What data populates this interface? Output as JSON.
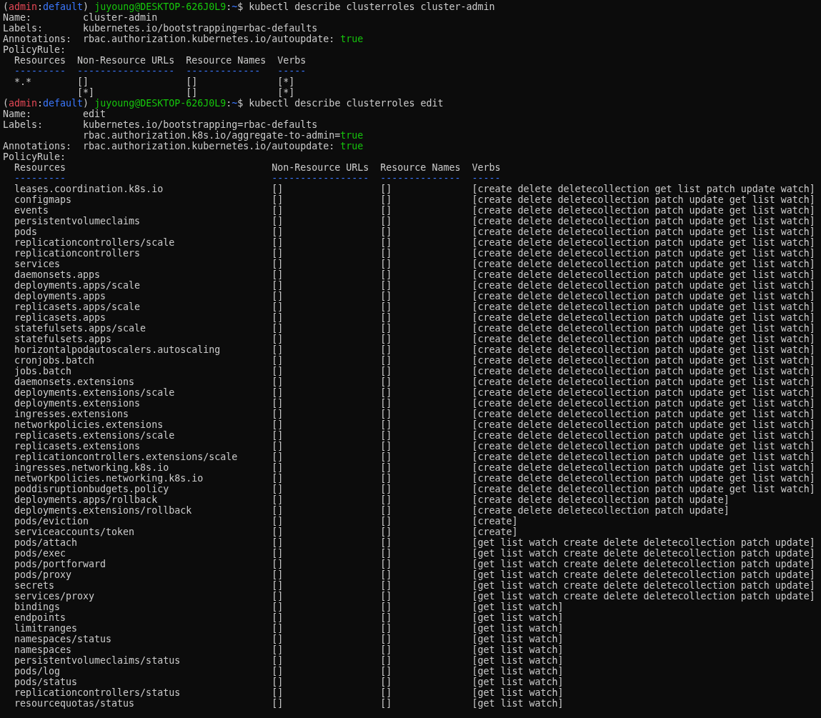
{
  "terminal": {
    "sessions": [
      {
        "prompt": [
          {
            "text": "(",
            "kind": "text"
          },
          {
            "text": "admin",
            "kind": "context"
          },
          {
            "text": ":",
            "kind": "text"
          },
          {
            "text": "default",
            "kind": "namespace"
          },
          {
            "text": ")",
            "kind": "text"
          },
          {
            "text": "juyoung@DESKTOP-626J0L9",
            "kind": "host"
          },
          {
            "text": ":",
            "kind": "text"
          },
          {
            "text": "~",
            "kind": "path"
          },
          {
            "text": "$",
            "kind": "text"
          }
        ],
        "command": "kubectl describe clusterroles cluster-admin",
        "fields": [
          {
            "label": "Name:",
            "values": [
              [
                {
                  "text": "cluster-admin",
                  "kind": "text"
                }
              ]
            ]
          },
          {
            "label": "Labels:",
            "values": [
              [
                {
                  "text": "kubernetes.io/bootstrapping=rbac-defaults",
                  "kind": "text"
                }
              ]
            ]
          },
          {
            "label": "Annotations:",
            "values": [
              [
                {
                  "text": "rbac.authorization.kubernetes.io/autoupdate: ",
                  "kind": "text"
                },
                {
                  "text": "true",
                  "kind": "bool"
                }
              ]
            ]
          }
        ],
        "section": "PolicyRule:",
        "table": {
          "columns": [
            {
              "header": "Resources",
              "rule": "---------"
            },
            {
              "header": "Non-Resource URLs",
              "rule": "-----------------"
            },
            {
              "header": "Resource Names",
              "rule": "-------------"
            },
            {
              "header": "Verbs",
              "rule": "-----"
            }
          ],
          "rows": [
            [
              "*.*",
              "[]",
              "[]",
              "[*]"
            ],
            [
              "",
              "[*]",
              "[]",
              "[*]"
            ]
          ]
        }
      },
      {
        "prompt": [
          {
            "text": "(",
            "kind": "text"
          },
          {
            "text": "admin",
            "kind": "context"
          },
          {
            "text": ":",
            "kind": "text"
          },
          {
            "text": "default",
            "kind": "namespace"
          },
          {
            "text": ")",
            "kind": "text"
          },
          {
            "text": "juyoung@DESKTOP-626J0L9",
            "kind": "host"
          },
          {
            "text": ":",
            "kind": "text"
          },
          {
            "text": "~",
            "kind": "path"
          },
          {
            "text": "$",
            "kind": "text"
          }
        ],
        "command": "kubectl describe clusterroles edit",
        "fields": [
          {
            "label": "Name:",
            "values": [
              [
                {
                  "text": "edit",
                  "kind": "text"
                }
              ]
            ]
          },
          {
            "label": "Labels:",
            "values": [
              [
                {
                  "text": "kubernetes.io/bootstrapping=rbac-defaults",
                  "kind": "text"
                }
              ],
              [
                {
                  "text": "rbac.authorization.k8s.io/aggregate-to-admin=",
                  "kind": "text"
                },
                {
                  "text": "true",
                  "kind": "bool"
                }
              ]
            ]
          },
          {
            "label": "Annotations:",
            "values": [
              [
                {
                  "text": "rbac.authorization.kubernetes.io/autoupdate: ",
                  "kind": "text"
                },
                {
                  "text": "true",
                  "kind": "bool"
                }
              ]
            ]
          }
        ],
        "section": "PolicyRule:",
        "table": {
          "columns": [
            {
              "header": "Resources",
              "rule": "---------"
            },
            {
              "header": "Non-Resource URLs",
              "rule": "-----------------"
            },
            {
              "header": "Resource Names",
              "rule": "--------------"
            },
            {
              "header": "Verbs",
              "rule": "-----"
            }
          ],
          "rows": [
            [
              "leases.coordination.k8s.io",
              "[]",
              "[]",
              "[create delete deletecollection get list patch update watch]"
            ],
            [
              "configmaps",
              "[]",
              "[]",
              "[create delete deletecollection patch update get list watch]"
            ],
            [
              "events",
              "[]",
              "[]",
              "[create delete deletecollection patch update get list watch]"
            ],
            [
              "persistentvolumeclaims",
              "[]",
              "[]",
              "[create delete deletecollection patch update get list watch]"
            ],
            [
              "pods",
              "[]",
              "[]",
              "[create delete deletecollection patch update get list watch]"
            ],
            [
              "replicationcontrollers/scale",
              "[]",
              "[]",
              "[create delete deletecollection patch update get list watch]"
            ],
            [
              "replicationcontrollers",
              "[]",
              "[]",
              "[create delete deletecollection patch update get list watch]"
            ],
            [
              "services",
              "[]",
              "[]",
              "[create delete deletecollection patch update get list watch]"
            ],
            [
              "daemonsets.apps",
              "[]",
              "[]",
              "[create delete deletecollection patch update get list watch]"
            ],
            [
              "deployments.apps/scale",
              "[]",
              "[]",
              "[create delete deletecollection patch update get list watch]"
            ],
            [
              "deployments.apps",
              "[]",
              "[]",
              "[create delete deletecollection patch update get list watch]"
            ],
            [
              "replicasets.apps/scale",
              "[]",
              "[]",
              "[create delete deletecollection patch update get list watch]"
            ],
            [
              "replicasets.apps",
              "[]",
              "[]",
              "[create delete deletecollection patch update get list watch]"
            ],
            [
              "statefulsets.apps/scale",
              "[]",
              "[]",
              "[create delete deletecollection patch update get list watch]"
            ],
            [
              "statefulsets.apps",
              "[]",
              "[]",
              "[create delete deletecollection patch update get list watch]"
            ],
            [
              "horizontalpodautoscalers.autoscaling",
              "[]",
              "[]",
              "[create delete deletecollection patch update get list watch]"
            ],
            [
              "cronjobs.batch",
              "[]",
              "[]",
              "[create delete deletecollection patch update get list watch]"
            ],
            [
              "jobs.batch",
              "[]",
              "[]",
              "[create delete deletecollection patch update get list watch]"
            ],
            [
              "daemonsets.extensions",
              "[]",
              "[]",
              "[create delete deletecollection patch update get list watch]"
            ],
            [
              "deployments.extensions/scale",
              "[]",
              "[]",
              "[create delete deletecollection patch update get list watch]"
            ],
            [
              "deployments.extensions",
              "[]",
              "[]",
              "[create delete deletecollection patch update get list watch]"
            ],
            [
              "ingresses.extensions",
              "[]",
              "[]",
              "[create delete deletecollection patch update get list watch]"
            ],
            [
              "networkpolicies.extensions",
              "[]",
              "[]",
              "[create delete deletecollection patch update get list watch]"
            ],
            [
              "replicasets.extensions/scale",
              "[]",
              "[]",
              "[create delete deletecollection patch update get list watch]"
            ],
            [
              "replicasets.extensions",
              "[]",
              "[]",
              "[create delete deletecollection patch update get list watch]"
            ],
            [
              "replicationcontrollers.extensions/scale",
              "[]",
              "[]",
              "[create delete deletecollection patch update get list watch]"
            ],
            [
              "ingresses.networking.k8s.io",
              "[]",
              "[]",
              "[create delete deletecollection patch update get list watch]"
            ],
            [
              "networkpolicies.networking.k8s.io",
              "[]",
              "[]",
              "[create delete deletecollection patch update get list watch]"
            ],
            [
              "poddisruptionbudgets.policy",
              "[]",
              "[]",
              "[create delete deletecollection patch update get list watch]"
            ],
            [
              "deployments.apps/rollback",
              "[]",
              "[]",
              "[create delete deletecollection patch update]"
            ],
            [
              "deployments.extensions/rollback",
              "[]",
              "[]",
              "[create delete deletecollection patch update]"
            ],
            [
              "pods/eviction",
              "[]",
              "[]",
              "[create]"
            ],
            [
              "serviceaccounts/token",
              "[]",
              "[]",
              "[create]"
            ],
            [
              "pods/attach",
              "[]",
              "[]",
              "[get list watch create delete deletecollection patch update]"
            ],
            [
              "pods/exec",
              "[]",
              "[]",
              "[get list watch create delete deletecollection patch update]"
            ],
            [
              "pods/portforward",
              "[]",
              "[]",
              "[get list watch create delete deletecollection patch update]"
            ],
            [
              "pods/proxy",
              "[]",
              "[]",
              "[get list watch create delete deletecollection patch update]"
            ],
            [
              "secrets",
              "[]",
              "[]",
              "[get list watch create delete deletecollection patch update]"
            ],
            [
              "services/proxy",
              "[]",
              "[]",
              "[get list watch create delete deletecollection patch update]"
            ],
            [
              "bindings",
              "[]",
              "[]",
              "[get list watch]"
            ],
            [
              "endpoints",
              "[]",
              "[]",
              "[get list watch]"
            ],
            [
              "limitranges",
              "[]",
              "[]",
              "[get list watch]"
            ],
            [
              "namespaces/status",
              "[]",
              "[]",
              "[get list watch]"
            ],
            [
              "namespaces",
              "[]",
              "[]",
              "[get list watch]"
            ],
            [
              "persistentvolumeclaims/status",
              "[]",
              "[]",
              "[get list watch]"
            ],
            [
              "pods/log",
              "[]",
              "[]",
              "[get list watch]"
            ],
            [
              "pods/status",
              "[]",
              "[]",
              "[get list watch]"
            ],
            [
              "replicationcontrollers/status",
              "[]",
              "[]",
              "[get list watch]"
            ],
            [
              "resourcequotas/status",
              "[]",
              "[]",
              "[get list watch]"
            ]
          ]
        }
      }
    ]
  }
}
